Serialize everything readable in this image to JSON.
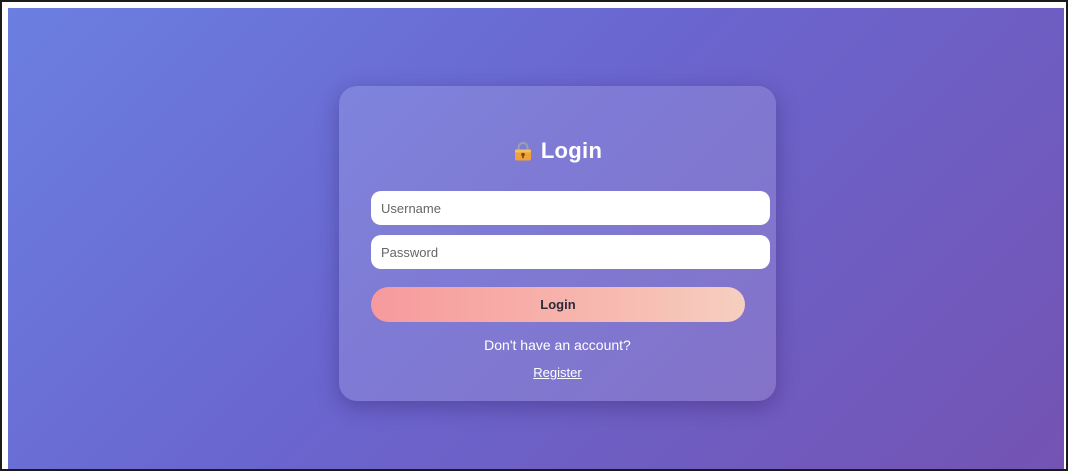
{
  "login_card": {
    "title": "Login",
    "title_icon": "lock-icon",
    "username_placeholder": "Username",
    "password_placeholder": "Password",
    "login_button_label": "Login",
    "account_prompt": "Don't have an account?",
    "register_link": "Register"
  },
  "colors": {
    "background_start": "#6b7fe0",
    "background_end": "#7453b3",
    "button_start": "#f79a9d",
    "button_end": "#f6cfc0"
  }
}
